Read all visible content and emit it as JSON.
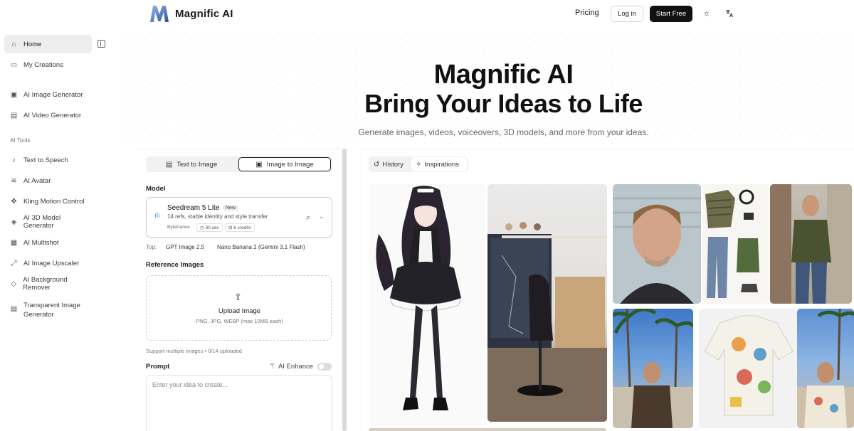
{
  "brand": {
    "name": "Magnific AI"
  },
  "header": {
    "pricing": "Pricing",
    "login": "Log in",
    "start_free": "Start Free"
  },
  "sidebar": {
    "items": [
      {
        "label": "Home",
        "icon": "home-icon",
        "active": true
      },
      {
        "label": "My Creations",
        "icon": "folder-icon"
      },
      {
        "label": "AI Image Generator",
        "icon": "image-icon"
      },
      {
        "label": "AI Video Generator",
        "icon": "video-file-icon"
      }
    ],
    "section_label": "AI Tools",
    "tools": [
      {
        "label": "Text to Speech",
        "icon": "mic-icon"
      },
      {
        "label": "AI Avatar",
        "icon": "waveform-icon"
      },
      {
        "label": "Kling Motion Control",
        "icon": "move-icon"
      },
      {
        "label": "AI 3D Model Generator",
        "icon": "cube-icon"
      },
      {
        "label": "AI Multishot",
        "icon": "grid-icon"
      },
      {
        "label": "AI Image Upscaler",
        "icon": "expand-icon"
      },
      {
        "label": "AI Background Remover",
        "icon": "eraser-icon"
      },
      {
        "label": "Transparent Image Generator",
        "icon": "transparent-file-icon"
      }
    ]
  },
  "hero": {
    "title_line1": "Magnific AI",
    "title_line2": "Bring Your Ideas to Life",
    "subtitle": "Generate images, videos, voiceovers, 3D models, and more from your ideas."
  },
  "form": {
    "tabs": [
      {
        "label": "Text to Image",
        "active": false
      },
      {
        "label": "Image to Image",
        "active": true
      }
    ],
    "model_label": "Model",
    "model": {
      "name": "Seedream 5 Lite",
      "badge": "New",
      "description": "14 refs, stable identity and style transfer",
      "provider": "ByteDance",
      "time": "30 sec",
      "credits": "6 credits"
    },
    "top_label": "Top:",
    "top_options": [
      "GPT Image 2.5",
      "Nano Banana 2 (Gemini 3.1 Flash)"
    ],
    "reference_label": "Reference Images",
    "upload_title": "Upload Image",
    "upload_sub": "PNG, JPG, WEBP (max 10MB each)",
    "support_text": "Support multiple images • 0/14 uploaded",
    "prompt_label": "Prompt",
    "enhance_label": "AI Enhance",
    "enhance_on": false,
    "prompt_placeholder": "Enter your idea to create..."
  },
  "gallery": {
    "tabs": [
      {
        "label": "History",
        "active": false
      },
      {
        "label": "Inspirations",
        "active": true
      }
    ]
  },
  "colors": {
    "accent_dark": "#111111",
    "sidebar_active": "#ededed",
    "model_icon": "#5a8de0"
  }
}
